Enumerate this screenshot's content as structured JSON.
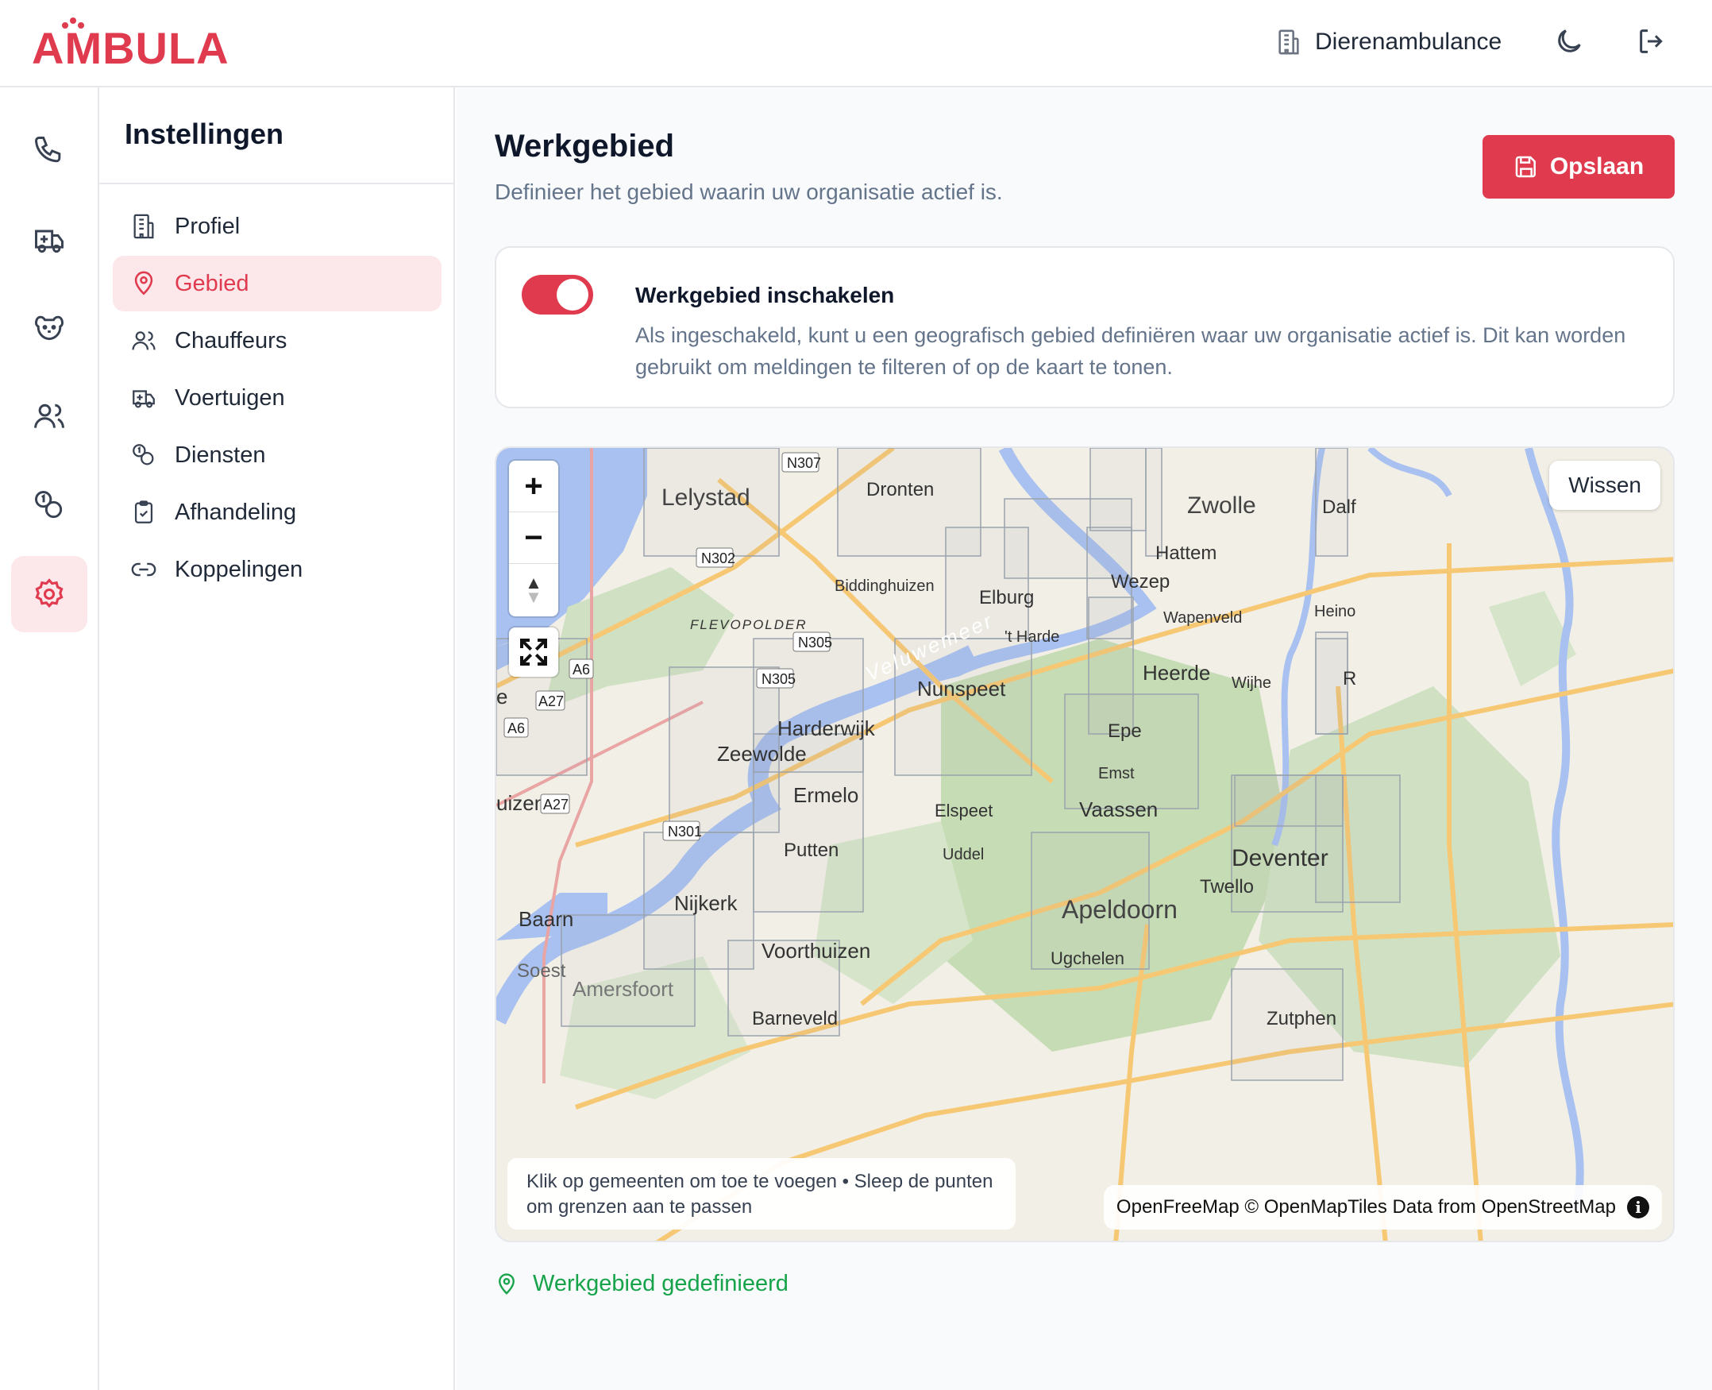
{
  "header": {
    "logo_text": "AMBULA",
    "org_name": "Dierenambulance",
    "brand_color": "#e03a4e",
    "icons": [
      "building-icon",
      "moon-icon",
      "logout-icon"
    ]
  },
  "rail": {
    "items": [
      {
        "icon": "phone-icon",
        "active": false
      },
      {
        "icon": "ambulance-icon",
        "active": false
      },
      {
        "icon": "animal-icon",
        "active": false
      },
      {
        "icon": "users-icon",
        "active": false
      },
      {
        "icon": "coins-icon",
        "active": false
      },
      {
        "icon": "settings-icon",
        "active": true
      }
    ]
  },
  "settings_nav": {
    "title": "Instellingen",
    "items": [
      {
        "label": "Profiel",
        "icon": "building-icon",
        "active": false
      },
      {
        "label": "Gebied",
        "icon": "map-pin-icon",
        "active": true
      },
      {
        "label": "Chauffeurs",
        "icon": "users-icon",
        "active": false
      },
      {
        "label": "Voertuigen",
        "icon": "ambulance-icon",
        "active": false
      },
      {
        "label": "Diensten",
        "icon": "coins-icon",
        "active": false
      },
      {
        "label": "Afhandeling",
        "icon": "clipboard-check-icon",
        "active": false
      },
      {
        "label": "Koppelingen",
        "icon": "link-icon",
        "active": false
      }
    ]
  },
  "main": {
    "title": "Werkgebied",
    "subtitle": "Definieer het gebied waarin uw organisatie actief is.",
    "save_label": "Opslaan",
    "toggle": {
      "enabled": true,
      "title": "Werkgebied inschakelen",
      "description": "Als ingeschakeld, kunt u een geografisch gebied definiëren waar uw organisatie actief is. Dit kan worden gebruikt om meldingen te filteren of op de kaart te tonen."
    },
    "map": {
      "clear_label": "Wissen",
      "zoom_in": "+",
      "zoom_out": "−",
      "compass": "▲",
      "hint": "Klik op gemeenten om toe te voegen • Sleep de punten om grenzen aan te passen",
      "attribution": "OpenFreeMap © OpenMapTiles Data from OpenStreetMap",
      "info": "i",
      "places": [
        "Lelystad",
        "Dronten",
        "Zwolle",
        "Dalf",
        "Hattem",
        "Wezep",
        "Biddinghuizen",
        "Elburg",
        "FLEVOPOLDER",
        "'t Harde",
        "Wapenveld",
        "Heino",
        "Veluwemeer",
        "Nunspeet",
        "Heerde",
        "Wijhe",
        "R",
        "e",
        "Harderwijk",
        "Zeewolde",
        "Epe",
        "Emst",
        "Ermelo",
        "Elspeet",
        "Vaassen",
        "uizen",
        "Putten",
        "Uddel",
        "Deventer",
        "Twello",
        "Nijkerk",
        "Baarn",
        "Apeldoorn",
        "Voorthuizen",
        "Soest",
        "Ugchelen",
        "Barneveld",
        "Zutphen",
        "Amersfoort"
      ],
      "roads": [
        "N307",
        "N302",
        "N305",
        "N305",
        "A6",
        "A27",
        "A6",
        "A27",
        "N301"
      ]
    },
    "status": "Werkgebied gedefinieerd"
  }
}
